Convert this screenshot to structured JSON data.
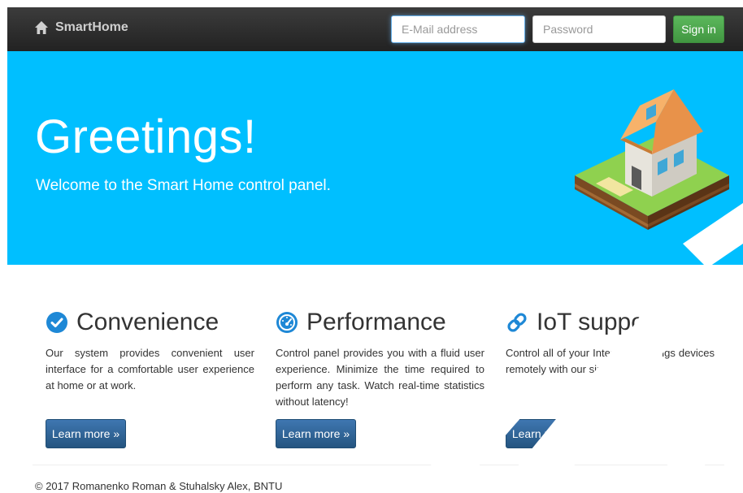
{
  "navbar": {
    "brand": "SmartHome",
    "brand_icon": "home-icon",
    "email_placeholder": "E-Mail address",
    "password_placeholder": "Password",
    "signin_label": "Sign in"
  },
  "hero": {
    "title": "Greetings!",
    "subtitle": "Welcome to the Smart Home control panel."
  },
  "features": [
    {
      "icon": "check-circle-icon",
      "title": "Convenience",
      "text": "Our system provides convenient user interface for a comfortable user experience at home or at work.",
      "button": "Learn more »"
    },
    {
      "icon": "dashboard-icon",
      "title": "Performance",
      "text": "Control panel provides you with a fluid user experience. Minimize the time required to perform any task. Watch real-time statistics without latency!",
      "button": "Learn more »"
    },
    {
      "icon": "link-icon",
      "title": "IoT support",
      "text": "Control all of your Internet of Things devices remotely with our single app!",
      "button": "Learn more »"
    }
  ],
  "footer": {
    "text": "© 2017 Romanenko Roman & Stuhalsky Alex, BNTU"
  },
  "colors": {
    "hero_bg": "#00bfff",
    "navbar_bg": "#222222",
    "signin_green": "#5cb85c",
    "button_blue": "#265a88",
    "feature_icon_blue": "#1e88d6"
  }
}
